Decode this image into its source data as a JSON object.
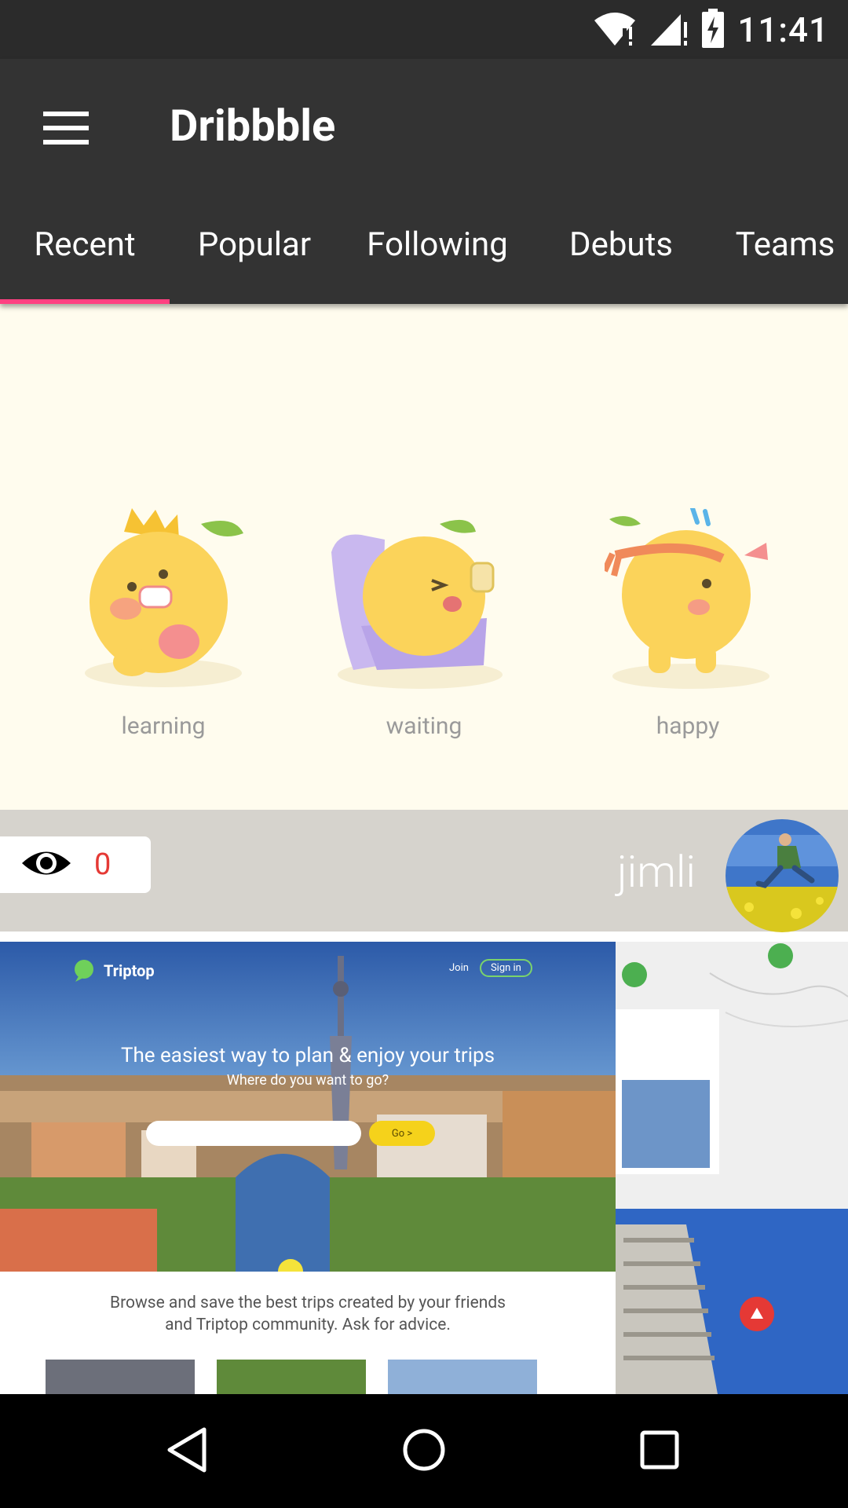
{
  "status_bar": {
    "time": "11:41",
    "icons": [
      "wifi-alert-icon",
      "signal-alert-icon",
      "battery-charging-icon"
    ]
  },
  "app_bar": {
    "title": "Dribbble",
    "menu_icon": "hamburger-menu-icon",
    "tabs": [
      {
        "label": "Recent",
        "active": true
      },
      {
        "label": "Popular",
        "active": false
      },
      {
        "label": "Following",
        "active": false
      },
      {
        "label": "Debuts",
        "active": false
      },
      {
        "label": "Teams",
        "active": false
      }
    ],
    "accent_color": "#ff4081"
  },
  "shots": [
    {
      "image": {
        "mascots": [
          {
            "label": "learning"
          },
          {
            "label": "waiting"
          },
          {
            "label": "happy"
          }
        ]
      },
      "views": "0",
      "views_icon": "eye-icon",
      "author": "jimli"
    },
    {
      "image": {
        "brand": "Triptop",
        "nav_join": "Join",
        "nav_signin": "Sign in",
        "headline": "The easiest way to plan & enjoy your trips",
        "subheadline": "Where do you want to go?",
        "go_label": "Go >",
        "browse_text_line1": "Browse and save the best trips created by your friends",
        "browse_text_line2": "and Triptop community. Ask for advice."
      }
    }
  ],
  "nav_bar": {
    "back": "back-icon",
    "home": "home-icon",
    "recents": "recents-icon"
  }
}
